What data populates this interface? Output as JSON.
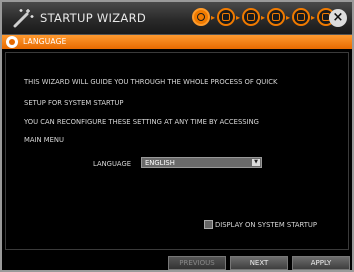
{
  "window": {
    "title": "STARTUP WIZARD",
    "section_title": "LANGUAGE"
  },
  "wizard_steps": [
    {
      "name": "language-step",
      "active": true
    },
    {
      "name": "date-time-step",
      "active": false
    },
    {
      "name": "record-step",
      "active": false
    },
    {
      "name": "network-step",
      "active": false
    },
    {
      "name": "display-step",
      "active": false
    },
    {
      "name": "finish-step",
      "active": false
    }
  ],
  "content": {
    "lines": [
      "THIS WIZARD WILL GUIDE YOU THROUGH THE WHOLE PROCESS OF QUICK",
      "SETUP FOR SYSTEM STARTUP",
      "YOU CAN RECONFIGURE THESE SETTING AT ANY TIME BY ACCESSING",
      "MAIN MENU"
    ],
    "language_label": "LANGUAGE",
    "language_value": "ENGLISH",
    "display_on_startup_label": "DISPLAY ON SYSTEM STARTUP",
    "display_on_startup_checked": false
  },
  "buttons": {
    "previous": "PREVIOUS",
    "next": "NEXT",
    "apply": "APPLY"
  },
  "colors": {
    "accent": "#f07a00",
    "background": "#000000"
  }
}
